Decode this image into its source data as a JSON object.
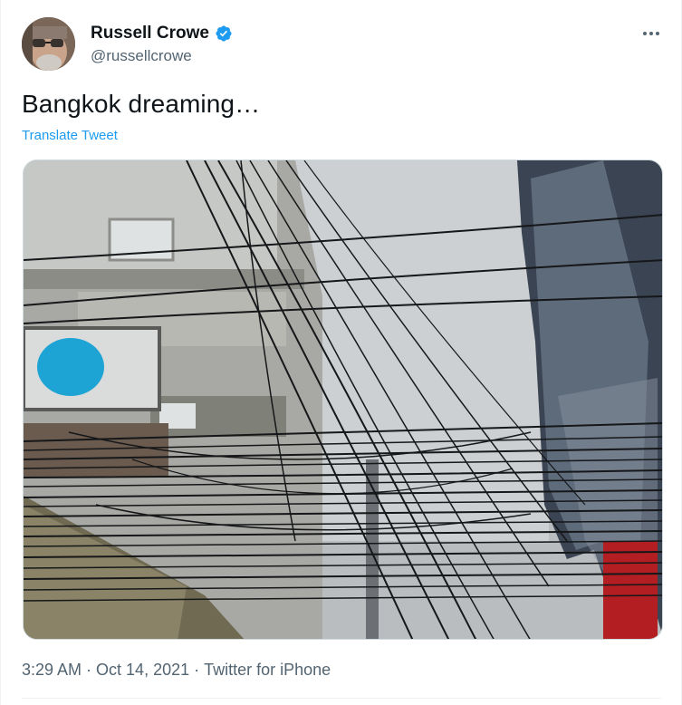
{
  "author": {
    "display_name": "Russell Crowe",
    "handle": "@russellcrowe",
    "verified": true,
    "avatar_icon": "profile-photo"
  },
  "menu": {
    "more_icon": "more-horizontal-icon"
  },
  "tweet": {
    "text": "Bangkok dreaming…",
    "translate_label": "Translate Tweet",
    "media_description_icon": "photo"
  },
  "footer": {
    "time": "3:29 AM",
    "separator": "·",
    "date": "Oct 14, 2021",
    "source": "Twitter for iPhone"
  },
  "colors": {
    "accent": "#1d9bf0",
    "text_primary": "#0f1419",
    "text_secondary": "#536471",
    "border": "#cfd9de"
  }
}
